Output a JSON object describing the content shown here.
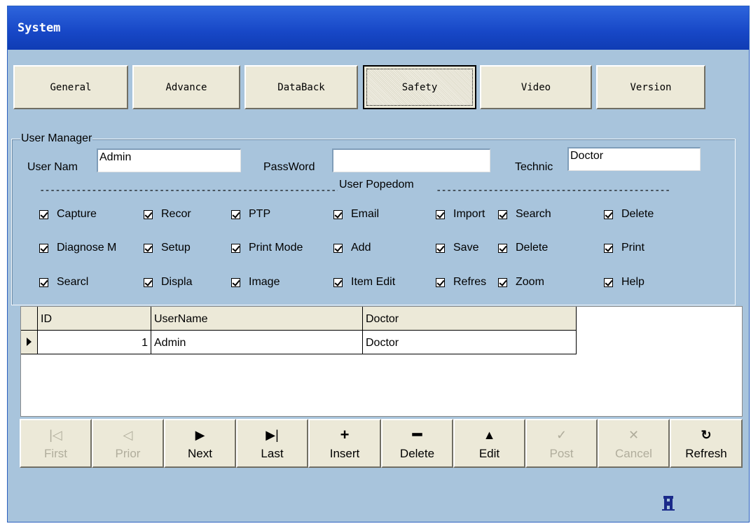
{
  "window": {
    "title": "System"
  },
  "tabs": [
    "General",
    "Advance",
    "DataBack",
    "Safety",
    "Video",
    "Version"
  ],
  "active_tab": "Safety",
  "user_manager": {
    "legend": "User Manager",
    "user_name_label": "User Nam",
    "user_name_value": "Admin",
    "password_label": "PassWord",
    "password_value": "",
    "technic_label": "Technic",
    "technic_value": "Doctor"
  },
  "popedom": {
    "title": "User Popedom",
    "rows": [
      [
        "Capture",
        "Recor",
        "PTP",
        "Email",
        "Import",
        "Search",
        "Delete"
      ],
      [
        "Diagnose M",
        "Setup",
        "Print Mode",
        "Add",
        "Save",
        "Delete",
        "Print"
      ],
      [
        "Searcl",
        "Displa",
        "Image",
        "Item Edit",
        "Refres",
        "Zoom",
        "Help"
      ]
    ]
  },
  "table": {
    "columns": [
      "ID",
      "UserName",
      "Doctor"
    ],
    "rows": [
      [
        "1",
        "Admin",
        "Doctor"
      ]
    ]
  },
  "navigator": [
    {
      "label": "First",
      "enabled": false,
      "icon": "first-icon"
    },
    {
      "label": "Prior",
      "enabled": false,
      "icon": "prior-icon"
    },
    {
      "label": "Next",
      "enabled": true,
      "icon": "next-icon"
    },
    {
      "label": "Last",
      "enabled": true,
      "icon": "last-icon"
    },
    {
      "label": "Insert",
      "enabled": true,
      "icon": "plus-icon"
    },
    {
      "label": "Delete",
      "enabled": true,
      "icon": "minus-icon"
    },
    {
      "label": "Edit",
      "enabled": true,
      "icon": "edit-icon"
    },
    {
      "label": "Post",
      "enabled": false,
      "icon": "check-icon"
    },
    {
      "label": "Cancel",
      "enabled": false,
      "icon": "cancel-icon"
    },
    {
      "label": "Refresh",
      "enabled": true,
      "icon": "refresh-icon"
    }
  ]
}
